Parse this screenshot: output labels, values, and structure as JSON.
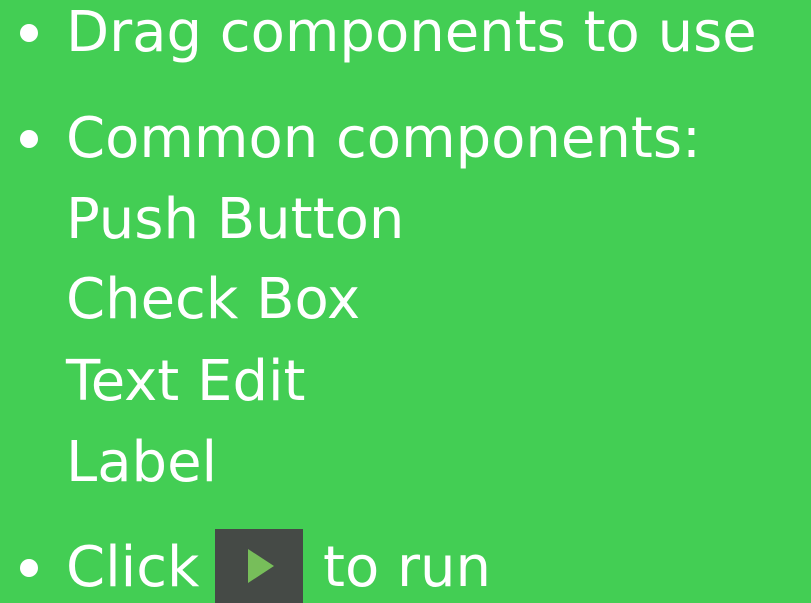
{
  "bullets": {
    "drag": "Drag components to use",
    "common_heading": "Common components:",
    "common_items": [
      "Push Button",
      "Check Box",
      "Text Edit",
      "Label"
    ],
    "run_prefix": "Click",
    "run_suffix": "to run"
  },
  "icons": {
    "run": "play-triangle-icon"
  },
  "colors": {
    "background": "#43ce54",
    "text": "#ffffff",
    "run_button_bg": "#454a46",
    "run_triangle": "#77be5a"
  }
}
